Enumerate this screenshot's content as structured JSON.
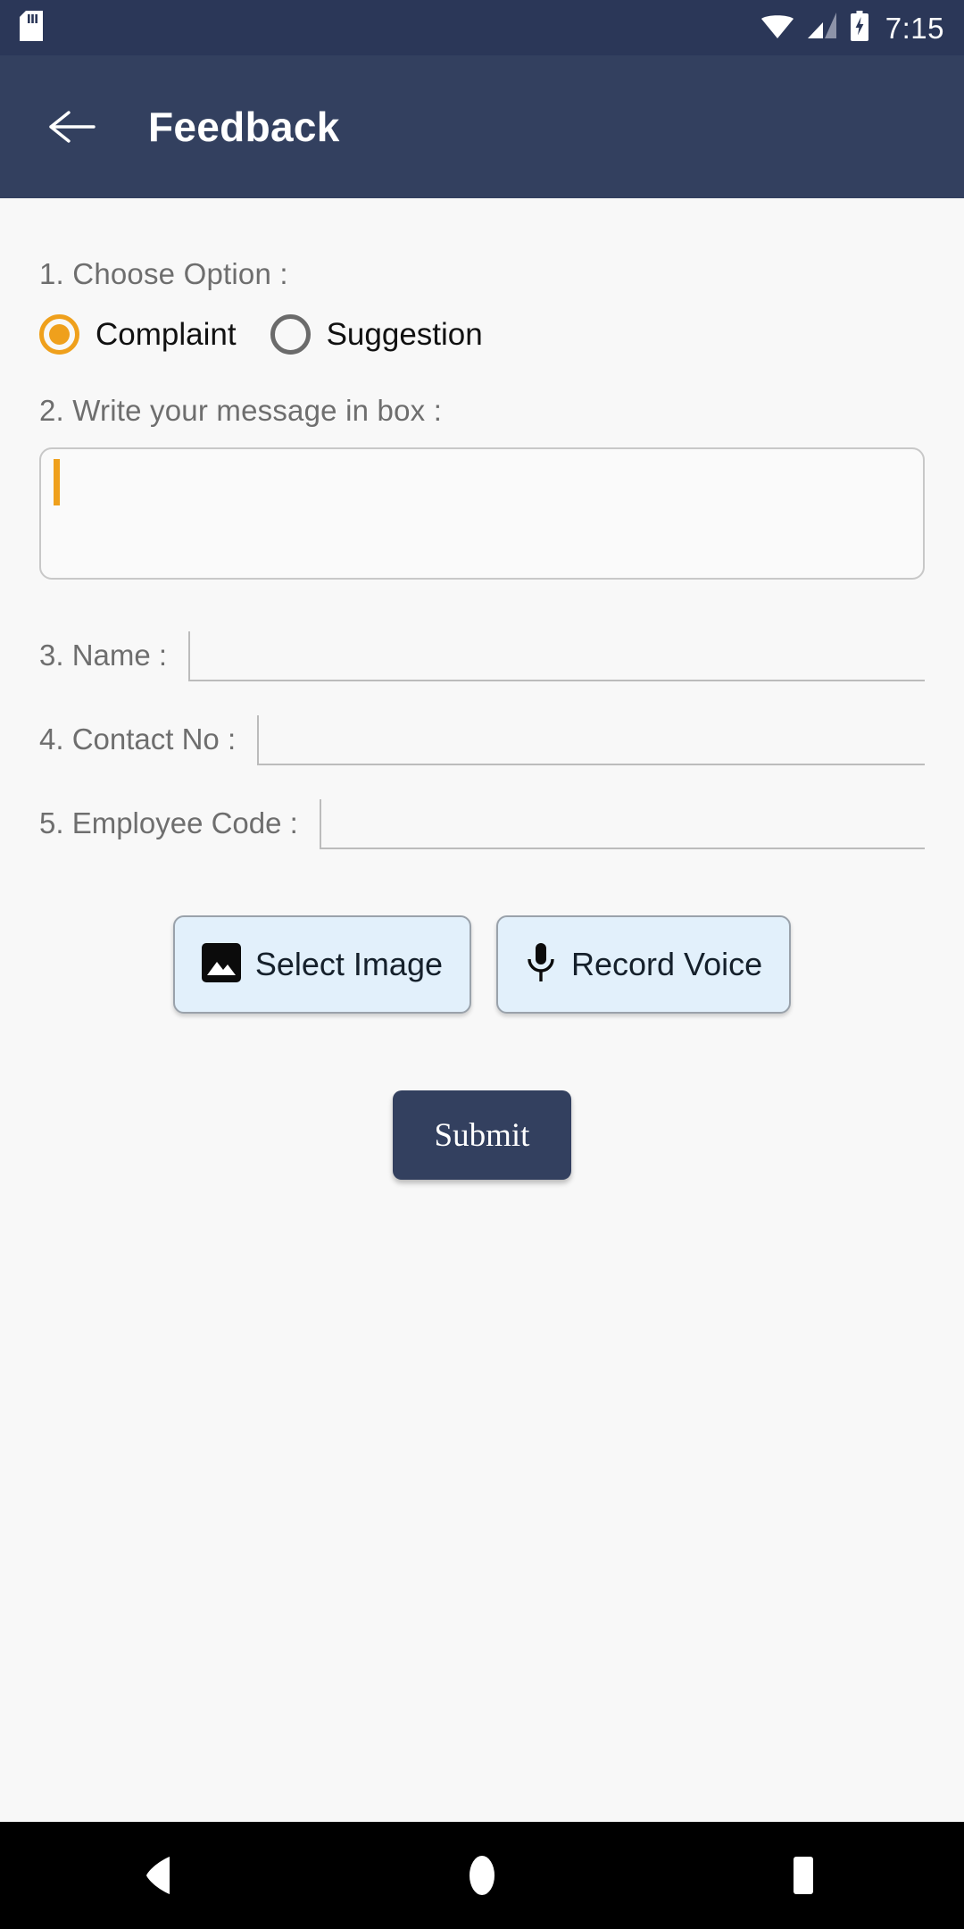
{
  "status_bar": {
    "time": "7:15",
    "icons": {
      "sd_card": "sd-card-icon",
      "wifi": "wifi-icon",
      "signal": "signal-cellular-icon",
      "battery": "battery-charging-icon"
    },
    "background_color": "#2b3758"
  },
  "app_bar": {
    "title": "Feedback",
    "back_icon": "arrow-left-icon",
    "background_color": "#33405f"
  },
  "form": {
    "q1": {
      "label": "1. Choose Option :",
      "options": [
        {
          "label": "Complaint",
          "selected": true
        },
        {
          "label": "Suggestion",
          "selected": false
        }
      ],
      "selected_color": "#efa01c"
    },
    "q2": {
      "label": "2. Write your message in box :",
      "value": "",
      "placeholder": "",
      "caret_color": "#efa01c"
    },
    "q3": {
      "label": "3. Name :",
      "value": "",
      "placeholder": ""
    },
    "q4": {
      "label": "4. Contact No :",
      "value": "",
      "placeholder": ""
    },
    "q5": {
      "label": "5. Employee Code :",
      "value": "",
      "placeholder": ""
    }
  },
  "media_buttons": [
    {
      "label": "Select Image",
      "icon": "image-icon"
    },
    {
      "label": "Record Voice",
      "icon": "microphone-icon"
    }
  ],
  "submit": {
    "label": "Submit",
    "background_color": "#33405f"
  },
  "nav_bar": {
    "back": "nav-back-icon",
    "home": "nav-home-icon",
    "recents": "nav-recents-icon",
    "background_color": "#000000"
  },
  "theme": {
    "page_background": "#f8f8f8",
    "accent": "#efa01c",
    "primary": "#33405f"
  }
}
